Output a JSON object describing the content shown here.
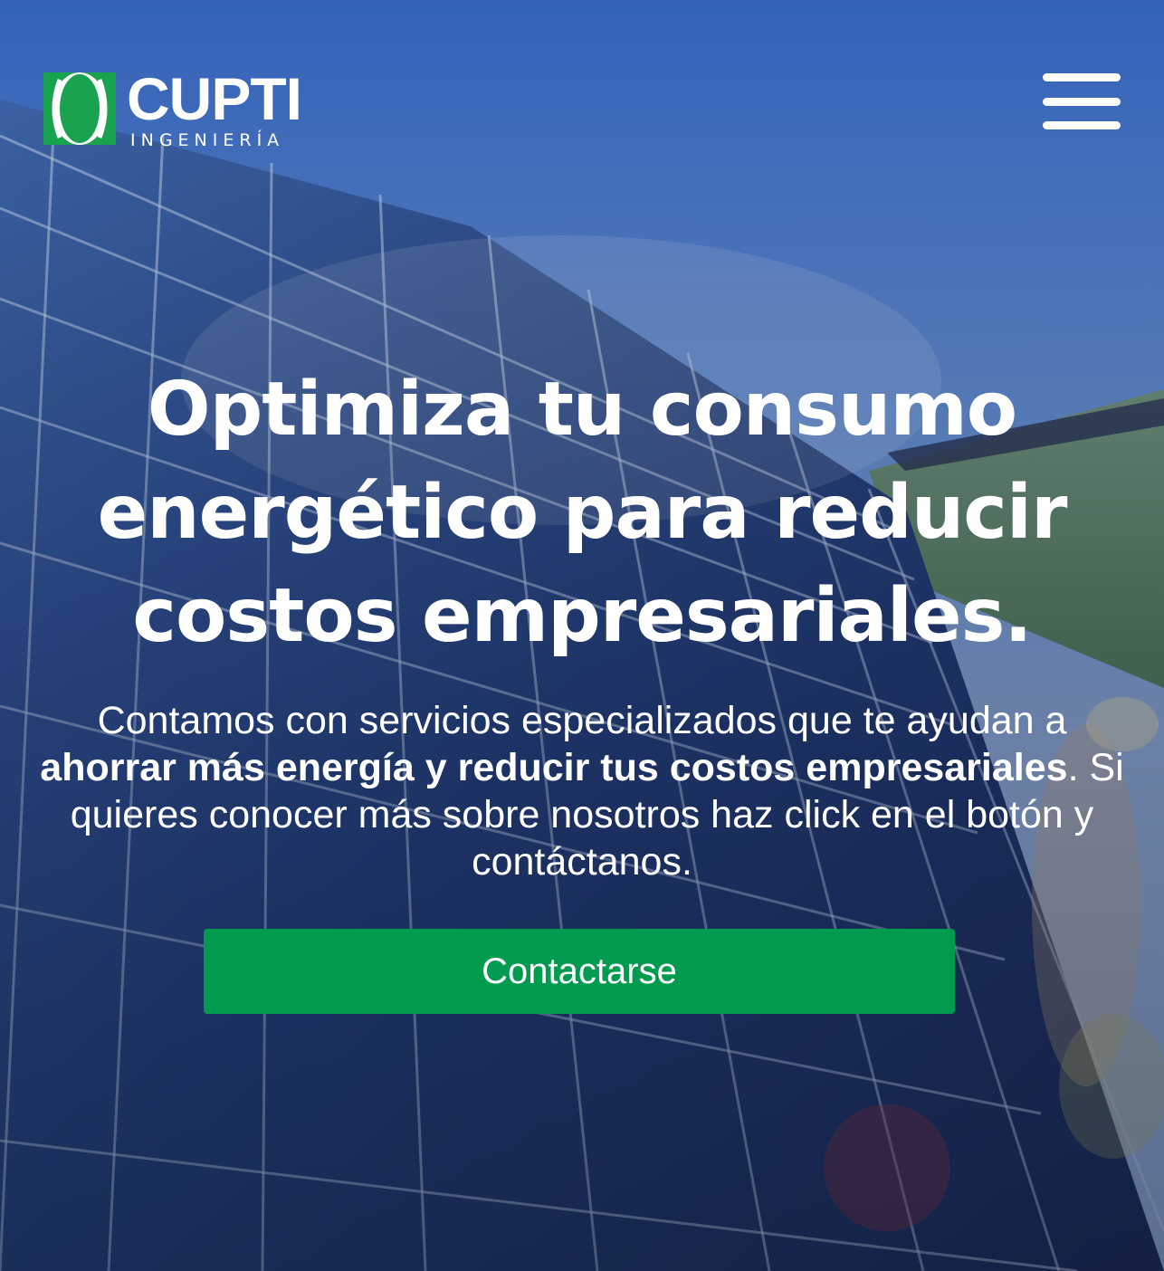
{
  "brand": {
    "name": "CUPTI",
    "subtitle": "INGENIERÍA",
    "logo_icon": "leaf-logo-icon",
    "colors": {
      "green": "#009b4e",
      "white": "#ffffff"
    }
  },
  "nav": {
    "menu_icon": "hamburger-menu-icon"
  },
  "hero": {
    "headline": "Optimiza tu consumo energético para reducir costos empresariales.",
    "body_part1": "Contamos con servicios especializados que te ayudan a ",
    "body_bold": "ahorrar más energía y reducir tus costos empresariales",
    "body_part2": ". Si quieres conocer más sobre nosotros haz click en el botón y contáctanos.",
    "cta_label": "Contactarse",
    "background": "solar-panels-image"
  }
}
